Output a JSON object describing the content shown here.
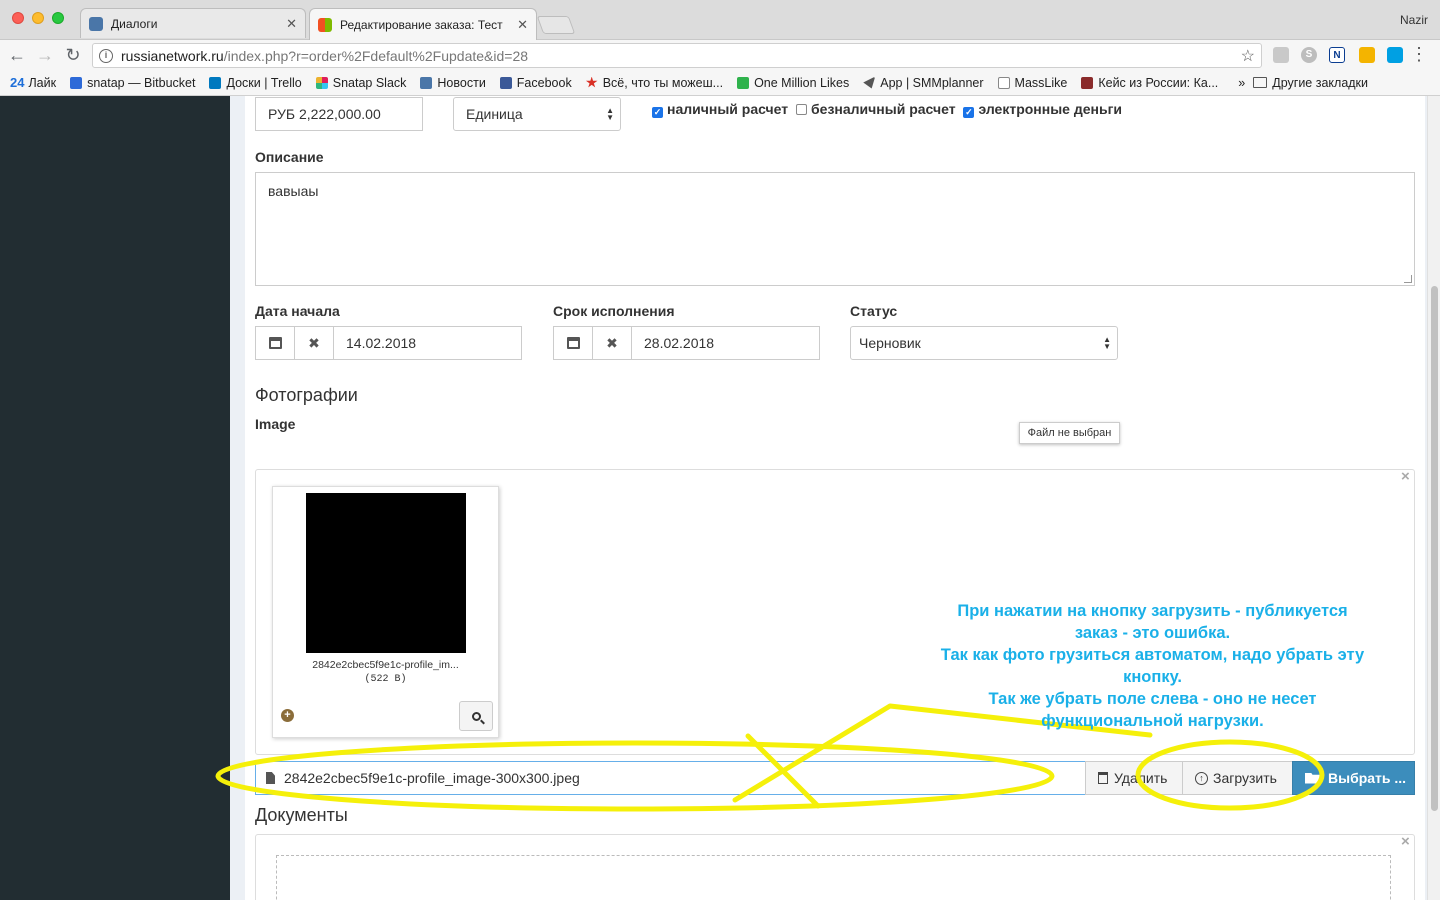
{
  "browser": {
    "tabs": [
      {
        "title": "Диалоги",
        "close": "✕"
      },
      {
        "title": "Редактирование заказа: Тест",
        "close": "✕"
      }
    ],
    "profile_name": "Nazir",
    "url_host": "russianetwork.ru",
    "url_path": "/index.php?r=order%2Fdefault%2Fupdate&id=28",
    "bookmarks": [
      {
        "label": "Лайк",
        "prefix": "24",
        "color": "#1e6fd9"
      },
      {
        "label": "snatap — Bitbucket",
        "color": "#2d6ad8"
      },
      {
        "label": "Доски | Trello",
        "color": "#0079bf"
      },
      {
        "label": "Snatap Slack",
        "color": "#e01e5a"
      },
      {
        "label": "Новости",
        "color": "#4a76a8"
      },
      {
        "label": "Facebook",
        "color": "#3b5998"
      },
      {
        "label": "Всё, что ты можеш...",
        "color": "#d93025"
      },
      {
        "label": "One Million Likes",
        "color": "#2fb24c"
      },
      {
        "label": "App | SMMplanner",
        "color": "#555555"
      },
      {
        "label": "MassLike",
        "color": "#888888"
      },
      {
        "label": "Кейс из России: Ка...",
        "color": "#8a2b2b"
      }
    ],
    "bookmarks_more": "»",
    "other_bookmarks": "Другие закладки"
  },
  "form": {
    "price_value": "РУБ 2,222,000.00",
    "unit_select": "Единица",
    "payment": {
      "cash": {
        "label": "наличный расчет",
        "checked": true
      },
      "cashless": {
        "label": "безналичный расчет",
        "checked": false
      },
      "emoney": {
        "label": "электронные деньги",
        "checked": true
      }
    },
    "description_label": "Описание",
    "description_value": "вавыаы",
    "start_date_label": "Дата начала",
    "start_date_value": "14.02.2018",
    "deadline_label": "Срок исполнения",
    "deadline_value": "28.02.2018",
    "status_label": "Статус",
    "status_value": "Черновик",
    "clear_glyph": "✖",
    "photos_heading": "Фотографии",
    "image_label": "Image",
    "file_tooltip": "Файл не выбран",
    "close_glyph": "×",
    "thumbnail": {
      "filename": "2842e2cbec5f9e1c-profile_im...",
      "size": "(522 B)",
      "move_glyph": "+"
    },
    "caption_value": "2842e2cbec5f9e1c-profile_image-300x300.jpeg",
    "delete_button": "Удалить",
    "upload_button": "Загрузить",
    "upload_glyph": "↑",
    "browse_button": "Выбрать ...",
    "documents_heading": "Документы"
  },
  "annotation": {
    "lines": [
      "При нажатии на кнопку загрузить - публикуется",
      "заказ - это ошибка.",
      "Так как фото грузиться автоматом, надо убрать эту",
      "кнопку.",
      "Так же убрать поле слева - оно не несет",
      "функциональной нагрузки."
    ],
    "text_color": "#1ab0e8",
    "marker_color": "#f5f00a"
  },
  "colors": {
    "sidebar": "#222d32",
    "primary_button": "#3c8dbc"
  }
}
